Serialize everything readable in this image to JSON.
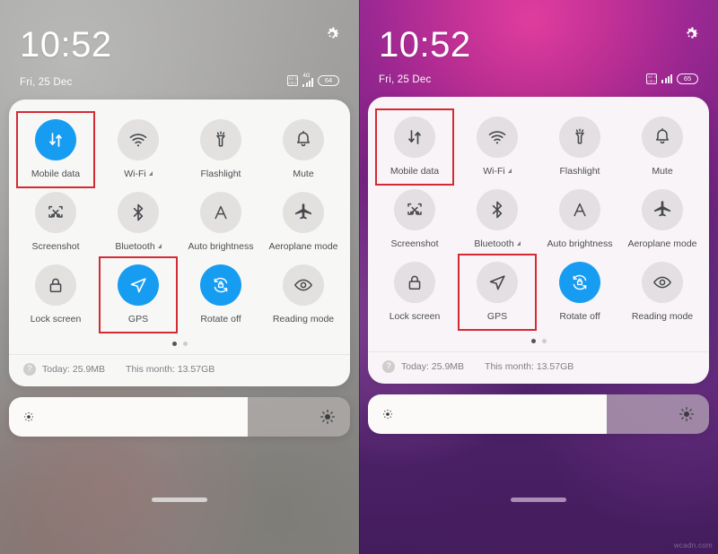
{
  "meta": {
    "watermark": "wcadn.com"
  },
  "panels": [
    {
      "id": "left",
      "status": {
        "time": "10:52",
        "date": "Fri, 25 Dec",
        "sim_icon": "dual-sim-icon",
        "network_label": "4G",
        "signal_icon": "signal-bars-icon",
        "battery_level": "64",
        "settings_icon": "gear-icon"
      },
      "tiles": [
        {
          "label": "Mobile data",
          "icon": "mobile-data-icon",
          "state": "on",
          "highlighted": true,
          "badge": ""
        },
        {
          "label": "Wi-Fi",
          "icon": "wifi-icon",
          "state": "off",
          "highlighted": false,
          "badge": "triangle"
        },
        {
          "label": "Flashlight",
          "icon": "flashlight-icon",
          "state": "off",
          "highlighted": false,
          "badge": ""
        },
        {
          "label": "Mute",
          "icon": "bell-icon",
          "state": "off",
          "highlighted": false,
          "badge": ""
        },
        {
          "label": "Screenshot",
          "icon": "screenshot-icon",
          "state": "off",
          "highlighted": false,
          "badge": ""
        },
        {
          "label": "Bluetooth",
          "icon": "bluetooth-icon",
          "state": "off",
          "highlighted": false,
          "badge": "triangle"
        },
        {
          "label": "Auto brightness",
          "icon": "auto-brightness-icon",
          "state": "off",
          "highlighted": false,
          "badge": ""
        },
        {
          "label": "Aeroplane mode",
          "icon": "airplane-icon",
          "state": "off",
          "highlighted": false,
          "badge": ""
        },
        {
          "label": "Lock screen",
          "icon": "lock-icon",
          "state": "off",
          "highlighted": false,
          "badge": ""
        },
        {
          "label": "GPS",
          "icon": "location-arrow-icon",
          "state": "on",
          "highlighted": true,
          "badge": ""
        },
        {
          "label": "Rotate off",
          "icon": "rotate-lock-icon",
          "state": "on",
          "highlighted": false,
          "badge": ""
        },
        {
          "label": "Reading mode",
          "icon": "eye-icon",
          "state": "off",
          "highlighted": false,
          "badge": ""
        }
      ],
      "pager": {
        "count": 2,
        "active": 0
      },
      "usage": {
        "help_icon": "?",
        "today": "Today: 25.9MB",
        "month": "This month: 13.57GB"
      },
      "brightness": {
        "value_percent": 70,
        "low_icon": "brightness-low-icon",
        "high_icon": "brightness-high-icon"
      }
    },
    {
      "id": "right",
      "status": {
        "time": "10:52",
        "date": "Fri, 25 Dec",
        "sim_icon": "dual-sim-icon",
        "network_label": "",
        "signal_icon": "signal-bars-icon",
        "battery_level": "65",
        "settings_icon": "gear-icon"
      },
      "tiles": [
        {
          "label": "Mobile data",
          "icon": "mobile-data-icon",
          "state": "off",
          "highlighted": true,
          "badge": ""
        },
        {
          "label": "Wi-Fi",
          "icon": "wifi-icon",
          "state": "off",
          "highlighted": false,
          "badge": "triangle"
        },
        {
          "label": "Flashlight",
          "icon": "flashlight-icon",
          "state": "off",
          "highlighted": false,
          "badge": ""
        },
        {
          "label": "Mute",
          "icon": "bell-icon",
          "state": "off",
          "highlighted": false,
          "badge": ""
        },
        {
          "label": "Screenshot",
          "icon": "screenshot-icon",
          "state": "off",
          "highlighted": false,
          "badge": ""
        },
        {
          "label": "Bluetooth",
          "icon": "bluetooth-icon",
          "state": "off",
          "highlighted": false,
          "badge": "triangle"
        },
        {
          "label": "Auto brightness",
          "icon": "auto-brightness-icon",
          "state": "off",
          "highlighted": false,
          "badge": ""
        },
        {
          "label": "Aeroplane mode",
          "icon": "airplane-icon",
          "state": "off",
          "highlighted": false,
          "badge": ""
        },
        {
          "label": "Lock screen",
          "icon": "lock-icon",
          "state": "off",
          "highlighted": false,
          "badge": ""
        },
        {
          "label": "GPS",
          "icon": "location-arrow-icon",
          "state": "off",
          "highlighted": true,
          "badge": ""
        },
        {
          "label": "Rotate off",
          "icon": "rotate-lock-icon",
          "state": "on",
          "highlighted": false,
          "badge": ""
        },
        {
          "label": "Reading mode",
          "icon": "eye-icon",
          "state": "off",
          "highlighted": false,
          "badge": ""
        }
      ],
      "pager": {
        "count": 2,
        "active": 0
      },
      "usage": {
        "help_icon": "?",
        "today": "Today: 25.9MB",
        "month": "This month: 13.57GB"
      },
      "brightness": {
        "value_percent": 70,
        "low_icon": "brightness-low-icon",
        "high_icon": "brightness-high-icon"
      }
    }
  ],
  "colors": {
    "accent_on": "#169df2",
    "highlight_box": "#d32b33",
    "tile_off_bg": "#e2e1e0",
    "card_bg_left": "#f7f7f6",
    "card_bg_right": "#f8f4f7"
  }
}
